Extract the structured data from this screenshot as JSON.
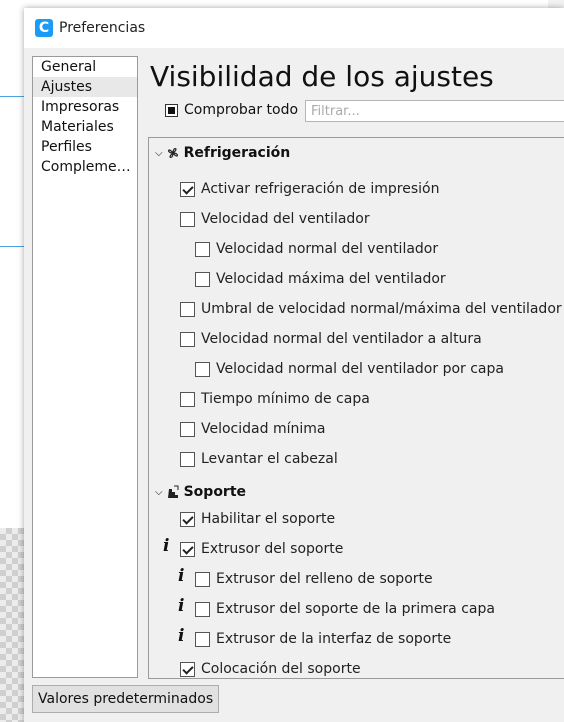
{
  "window": {
    "title": "Preferencias",
    "app_icon_letter": "C",
    "accent_color": "#1a9bf5"
  },
  "sidebar": {
    "items": [
      {
        "label": "General"
      },
      {
        "label": "Ajustes",
        "active": true
      },
      {
        "label": "Impresoras"
      },
      {
        "label": "Materiales"
      },
      {
        "label": "Perfiles"
      },
      {
        "label": "Complement..."
      }
    ]
  },
  "main": {
    "title": "Visibilidad de los ajustes",
    "check_all_label": "Comprobar todo",
    "filter_placeholder": "Filtrar..."
  },
  "categories": [
    {
      "label": "Refrigeración",
      "icon": "fan-icon",
      "settings": [
        {
          "label": "Activar refrigeración de impresión",
          "checked": true
        },
        {
          "label": "Velocidad del ventilador",
          "checked": false
        },
        {
          "label": "Velocidad normal del ventilador",
          "checked": false
        },
        {
          "label": "Velocidad máxima del ventilador",
          "checked": false
        },
        {
          "label": "Umbral de velocidad normal/máxima del ventilador",
          "checked": false
        },
        {
          "label": "Velocidad normal del ventilador a altura",
          "checked": false
        },
        {
          "label": "Velocidad normal del ventilador por capa",
          "checked": false
        },
        {
          "label": "Tiempo mínimo de capa",
          "checked": false
        },
        {
          "label": "Velocidad mínima",
          "checked": false
        },
        {
          "label": "Levantar el cabezal",
          "checked": false
        }
      ]
    },
    {
      "label": "Soporte",
      "icon": "support-icon",
      "settings": [
        {
          "label": "Habilitar el soporte",
          "checked": true
        },
        {
          "label": "Extrusor del soporte",
          "checked": true,
          "info": true
        },
        {
          "label": "Extrusor del relleno de soporte",
          "checked": false,
          "info": true
        },
        {
          "label": "Extrusor del soporte de la primera capa",
          "checked": false,
          "info": true
        },
        {
          "label": "Extrusor de la interfaz de soporte",
          "checked": false,
          "info": true
        },
        {
          "label": "Colocación del soporte",
          "checked": true
        }
      ]
    }
  ],
  "footer": {
    "defaults_label": "Valores predeterminados"
  }
}
